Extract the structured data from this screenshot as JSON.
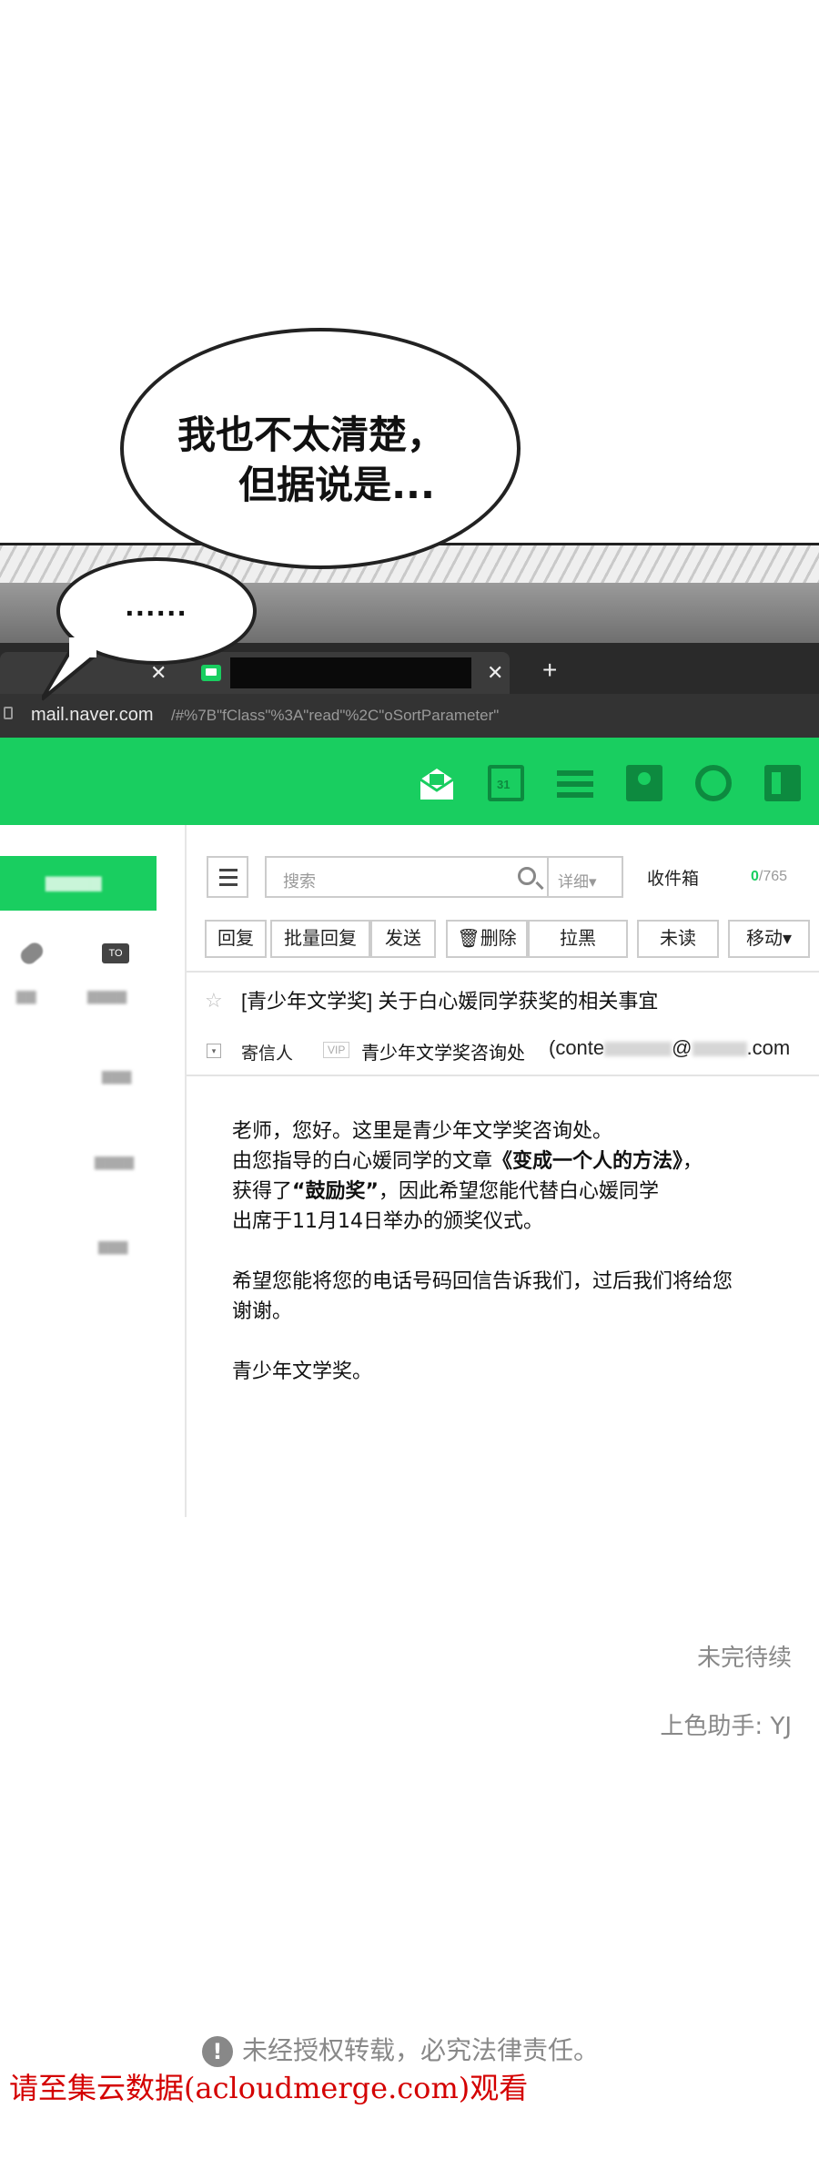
{
  "bubbles": {
    "main_line1": "我也不太清楚，",
    "main_line2": "但据说是...",
    "small": "......"
  },
  "browser": {
    "url_host": "mail.naver.com",
    "url_rest": "/#%7B\"fClass\"%3A\"read\"%2C\"oSortParameter\""
  },
  "toolbar": {
    "search_placeholder": "搜索",
    "detail_label": "详细▾",
    "inbox_label": "收件箱",
    "count_unread": "0",
    "count_total": "/765",
    "buttons": [
      "回复",
      "批量回复",
      "发送",
      "删除",
      "拉黑",
      "未读",
      "移动▾"
    ]
  },
  "mail": {
    "subject": "[青少年文学奖] 关于白心媛同学获奖的相关事宜",
    "sender_label": "寄信人",
    "vip": "VIP",
    "sender_name": "青少年文学奖咨询处",
    "sender_email_prefix": "(conte",
    "sender_email_mid": "@",
    "sender_email_suffix": ".com",
    "body": {
      "line1": "老师，您好。这里是青少年文学奖咨询处。",
      "line2a": "由您指导的白心媛同学的文章",
      "line2b": "《变成一个人的方法》",
      "line2c": "，",
      "line3a": "获得了",
      "line3b": "“鼓励奖”",
      "line3c": "，因此希望您能代替白心媛同学",
      "line4": "出席于11月14日举办的颁奖仪式。",
      "line5": "希望您能将您的电话号码回信告诉我们，过后我们将给您",
      "line6": "谢谢。",
      "line7": "青少年文学奖。"
    }
  },
  "footer": {
    "to_be_continued": "未完待续",
    "colorist": "上色助手: YJ",
    "notice": "未经授权转载，必究法律责任。",
    "watermark": "请至集云数据(acloudmerge.com)观看"
  }
}
